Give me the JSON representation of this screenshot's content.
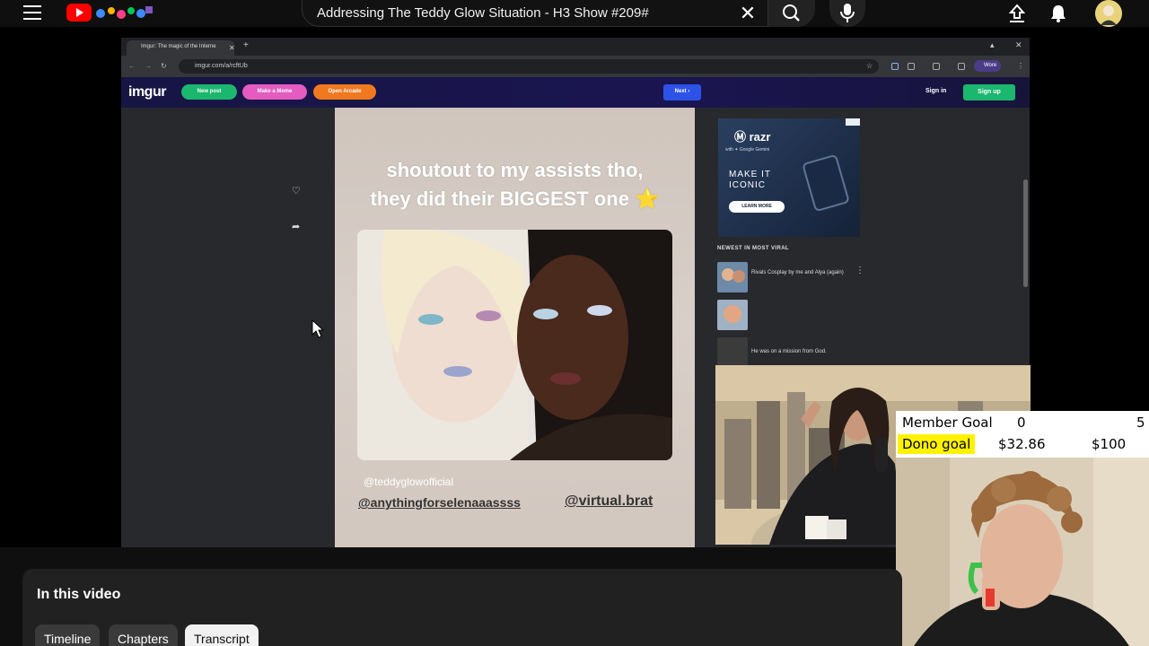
{
  "youtube": {
    "search_query": "Addressing The Teddy Glow Situation - H3 Show #209#"
  },
  "browser": {
    "tab_title": "Imgur: The magic of the Interne",
    "url": "imgur.com/a/rcftUb",
    "profile_label": "Wore"
  },
  "imgur": {
    "logo": "imgur",
    "new_post": "New post",
    "make_meme": "Make a Meme",
    "open_arcade": "Open Arcade",
    "next": "Next",
    "sign_in": "Sign in",
    "sign_up": "Sign up",
    "post": {
      "caption_line1": "shoutout to my assists tho,",
      "caption_line2": "they did their BIGGEST one ⭐",
      "handle1": "@teddyglowofficial",
      "handle2": "@anythingforselenaaassss",
      "handle3": "@virtual.brat"
    },
    "ad": {
      "brand": "razr",
      "sub": "with ✦ Google Gemini",
      "headline_line1": "MAKE IT",
      "headline_line2": "ICONIC",
      "cta": "LEARN MORE"
    },
    "viral": {
      "title": "NEWEST IN MOST VIRAL",
      "items": [
        {
          "text": "Rivals Cosplay by me and Alya (again)"
        },
        {
          "text": ""
        },
        {
          "text": "He was on a mission from God."
        }
      ]
    }
  },
  "goals": {
    "member_label": "Member Goal",
    "member_start": "0",
    "member_end": "5",
    "dono_label": "Dono goal",
    "dono_start": "$32.86",
    "dono_end": "$100"
  },
  "panel": {
    "title": "In this video",
    "chips": [
      "Timeline",
      "Chapters",
      "Transcript"
    ],
    "active_chip": "Transcript"
  },
  "colors": {
    "youtube_red": "#ff0000",
    "imgur_green": "#1bb76e",
    "imgur_blue": "#2c52e8",
    "dono_highlight": "#fff200"
  }
}
